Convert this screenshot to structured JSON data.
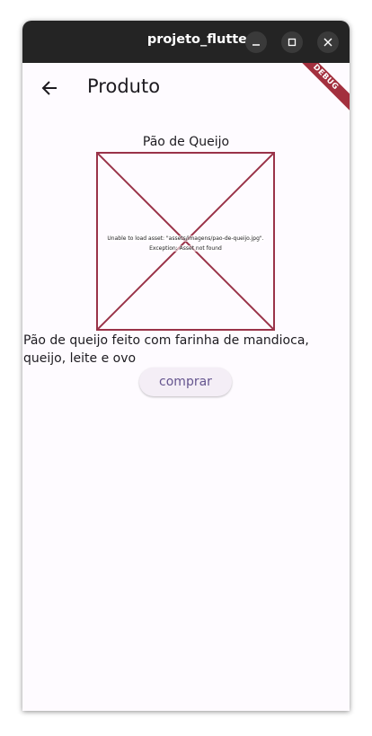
{
  "window": {
    "title": "projeto_flutter"
  },
  "appbar": {
    "title": "Produto"
  },
  "debug_banner": "DEBUG",
  "product": {
    "name": "Pão de Queijo",
    "image_error_line1": "Unable to load asset: \"assets/imagens/pao-de-queijo.jpg\".",
    "image_error_line2": "Exception: Asset not found",
    "description": "Pão de queijo feito com farinha de mandioca, queijo, leite e ovo",
    "buy_label": "comprar"
  },
  "colors": {
    "titlebar": "#242424",
    "background": "#fefbff",
    "error_border": "#9a3349",
    "button_text": "#65558f"
  }
}
